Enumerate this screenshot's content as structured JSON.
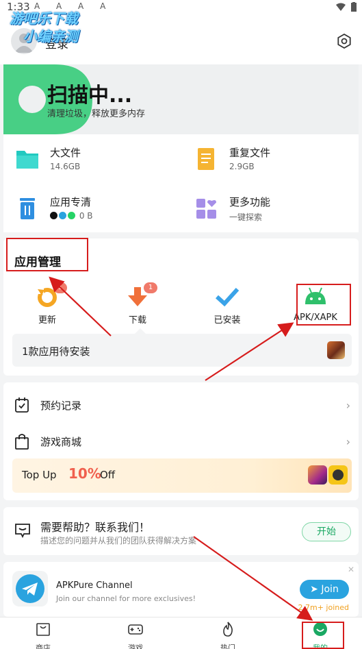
{
  "status_bar": {
    "time": "1:33",
    "icons": "A A A A"
  },
  "watermark": {
    "line1": "游吧乐下载",
    "line2": "小编亲测"
  },
  "header": {
    "login_label": "登录"
  },
  "scan": {
    "title": "扫描中...",
    "subtitle": "清理垃圾，释放更多内存"
  },
  "tools": [
    {
      "title": "大文件",
      "sub": "14.6GB",
      "icon": "folder-icon",
      "color": "#22c9c0"
    },
    {
      "title": "重复文件",
      "sub": "2.9GB",
      "icon": "document-icon",
      "color": "#f5b432"
    },
    {
      "title": "应用专清",
      "sub": "0 B",
      "icon": "trash-icon",
      "color": "#2f8fe0"
    },
    {
      "title": "更多功能",
      "sub": "一键探索",
      "icon": "more-features-icon",
      "color": "#a58ee8"
    }
  ],
  "app_management": {
    "title": "应用管理",
    "items": [
      {
        "label": "更新",
        "badge": "1",
        "icon": "update-icon"
      },
      {
        "label": "下载",
        "badge": "1",
        "icon": "download-icon"
      },
      {
        "label": "已安装",
        "badge": "",
        "icon": "check-icon"
      },
      {
        "label": "APK/XAPK",
        "badge": "",
        "icon": "android-icon"
      }
    ],
    "pending_text": "1款应用待安装"
  },
  "list": {
    "reservation": "预约记录",
    "game_store": "游戏商城",
    "topup_prefix": "Top Up",
    "topup_percent": "10%",
    "topup_suffix": "Off"
  },
  "help": {
    "title": "需要帮助？联系我们！",
    "desc": "描述您的问题并从我们的团队获得解决方案",
    "button": "开始"
  },
  "channel": {
    "title": "APKPure Channel",
    "desc": "Join our channel for more exclusives!",
    "button": "Join",
    "joined": "2.7m+ joined"
  },
  "bottom_nav": [
    {
      "label": "商店",
      "icon": "store-icon"
    },
    {
      "label": "游戏",
      "icon": "gamepad-icon"
    },
    {
      "label": "热门",
      "icon": "flame-icon"
    },
    {
      "label": "我的",
      "icon": "profile-icon"
    }
  ],
  "colors": {
    "accent_green": "#1aa863",
    "annotation_red": "#d61c1c",
    "badge": "#f07a6a"
  }
}
